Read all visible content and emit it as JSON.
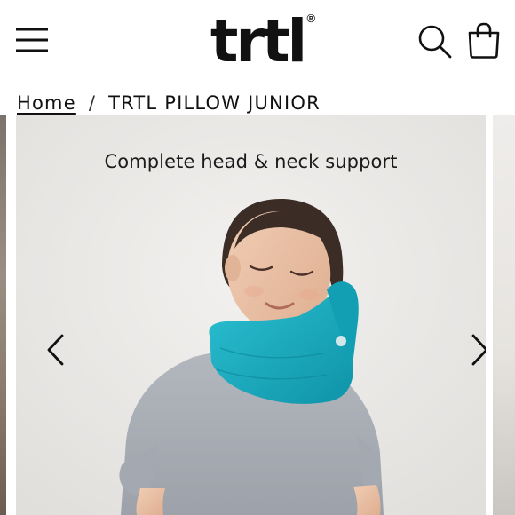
{
  "header": {
    "logo_text": "trtl",
    "logo_mark": "®",
    "menu_icon": "hamburger-menu-icon",
    "search_icon": "search-icon",
    "cart_icon": "shopping-bag-icon"
  },
  "breadcrumb": {
    "home_label": "Home",
    "separator": "/",
    "current_label": "TRTL PILLOW JUNIOR"
  },
  "gallery": {
    "caption": "Complete head & neck support",
    "prev_icon": "chevron-left-icon",
    "next_icon": "chevron-right-icon"
  },
  "colors": {
    "text": "#111111",
    "slide_background": "#ebe9e7",
    "pillow_teal": "#1ab0c4",
    "shirt_grey": "#a7abb3"
  }
}
